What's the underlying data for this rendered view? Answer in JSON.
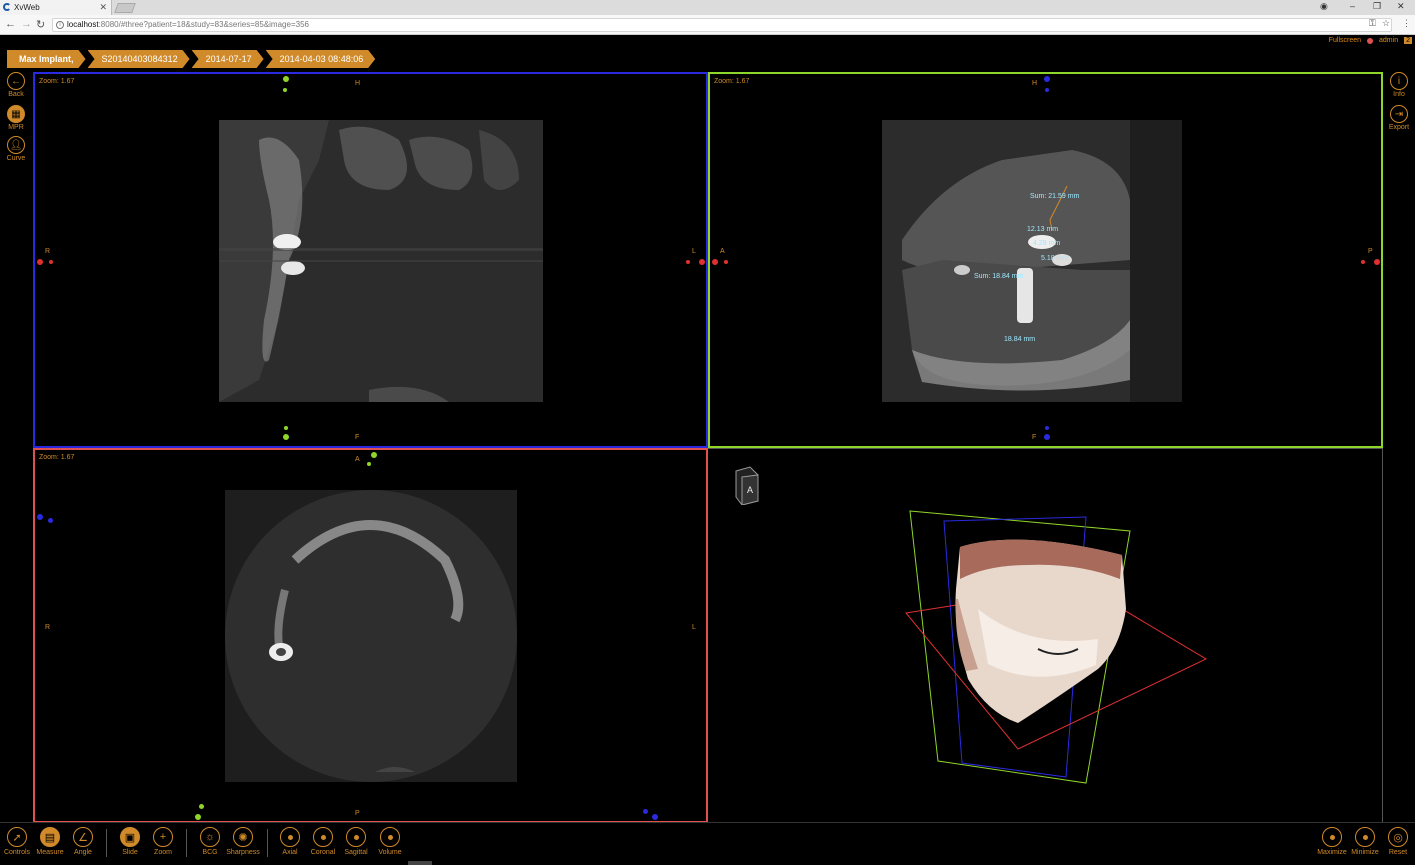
{
  "browser": {
    "tab_title": "XvWeb",
    "url_host": "localhost",
    "url_rest": ":8080/#three?patient=18&study=83&series=85&image=356"
  },
  "header": {
    "fullscreen": "Fullscreen",
    "user": "admin",
    "badge": "2"
  },
  "breadcrumb": [
    "Max Implant,",
    "S20140403084312",
    "2014-07-17",
    "2014-04-03 08:48:06"
  ],
  "left_tools": [
    {
      "label": "Back",
      "icon": "back-arrow-icon"
    },
    {
      "label": "MPR",
      "icon": "grid-icon"
    },
    {
      "label": "Curve",
      "icon": "person-icon"
    }
  ],
  "right_tools": [
    {
      "label": "Info",
      "icon": "info-icon"
    },
    {
      "label": "Export",
      "icon": "export-icon"
    }
  ],
  "viewports": {
    "coronal": {
      "zoom": "Zoom: 1.67",
      "top": "H",
      "bottom": "F",
      "left": "R",
      "right": "L"
    },
    "sagittal": {
      "zoom": "Zoom: 1.67",
      "top": "H",
      "bottom": "F",
      "left": "A",
      "right": "P"
    },
    "axial": {
      "zoom": "Zoom: 1.67",
      "top": "A",
      "bottom": "P",
      "left": "R",
      "right": "L"
    },
    "volume": {
      "cube_label": "A"
    }
  },
  "measurements": {
    "sum1": "Sum: 21.59 mm",
    "m1": "12.13 mm",
    "m2": "4.28 mm",
    "m3": "5.18 mm",
    "sum2": "Sum: 18.84 mm",
    "m4": "18.84 mm"
  },
  "toolbar": {
    "left": [
      {
        "label": "Controls",
        "icon": "pointer-icon"
      },
      {
        "label": "Measure",
        "icon": "ruler-icon"
      },
      {
        "label": "Angle",
        "icon": "angle-icon"
      },
      {
        "label": "Slide",
        "icon": "save-icon"
      },
      {
        "label": "Zoom",
        "icon": "zoom-plus-icon"
      },
      {
        "label": "BCG",
        "icon": "brightness-icon"
      },
      {
        "label": "Sharpness",
        "icon": "sharpness-icon"
      },
      {
        "label": "Axial",
        "icon": "axial-icon"
      },
      {
        "label": "Coronal",
        "icon": "coronal-icon"
      },
      {
        "label": "Sagittal",
        "icon": "sagittal-icon"
      },
      {
        "label": "Volume",
        "icon": "volume-icon"
      }
    ],
    "right": [
      {
        "label": "Maximize",
        "icon": "maximize-icon"
      },
      {
        "label": "Minimize",
        "icon": "minimize-icon"
      },
      {
        "label": "Reset",
        "icon": "reset-icon"
      }
    ]
  },
  "colors": {
    "accent": "#d08a2a",
    "coronal_border": "#2a2ae0",
    "sagittal_border": "#8fd62a",
    "axial_border": "#e05050"
  }
}
